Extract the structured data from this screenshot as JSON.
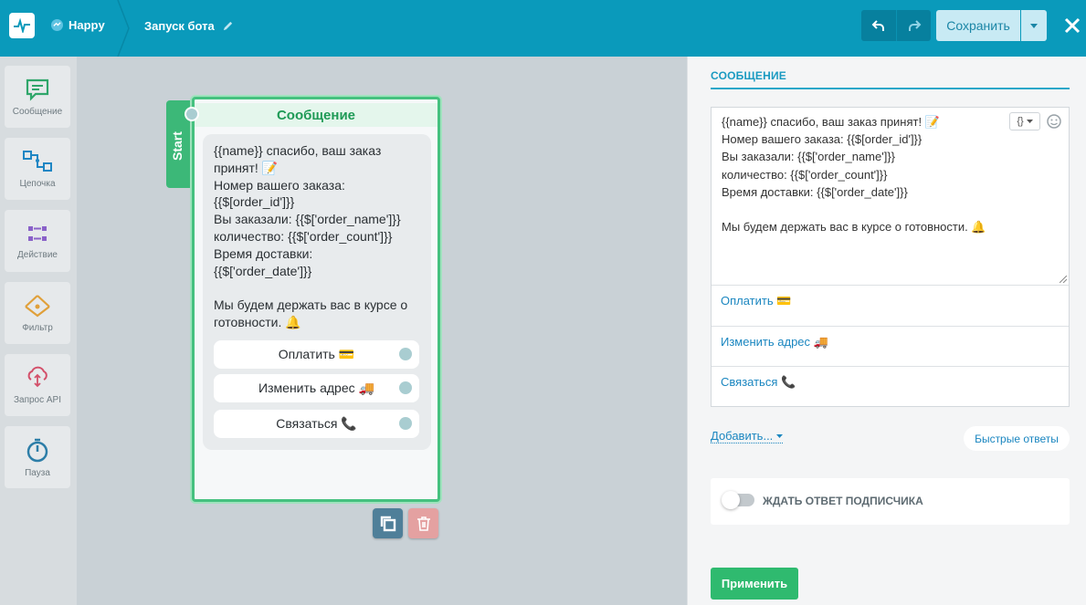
{
  "header": {
    "bot_name": "Happy",
    "flow_name": "Запуск бота",
    "save_label": "Сохранить"
  },
  "toolbox": {
    "items": [
      {
        "label": "Сообщение",
        "icon": "message-icon"
      },
      {
        "label": "Цепочка",
        "icon": "chain-icon"
      },
      {
        "label": "Действие",
        "icon": "action-icon"
      },
      {
        "label": "Фильтр",
        "icon": "filter-icon"
      },
      {
        "label": "Запрос API",
        "icon": "api-request-icon"
      },
      {
        "label": "Пауза",
        "icon": "timer-icon"
      }
    ]
  },
  "node": {
    "start_label": "Start",
    "title": "Сообщение",
    "text": "{{name}} спасибо, ваш заказ\nпринят! 📝\nНомер вашего заказа:\n{{$[order_id']}}\nВы заказали: {{$['order_name']}}\nколичество: {{$['order_count']}}\nВремя доставки:\n{{$['order_date']}}\n\nМы будем держать вас в курсе о\nготовности. 🔔",
    "buttons": [
      {
        "label": "Оплатить 💳"
      },
      {
        "label": "Изменить адрес 🚚"
      },
      {
        "label": "Связаться 📞"
      }
    ]
  },
  "panel": {
    "title": "СООБЩЕНИЕ",
    "message_text": "{{name}} спасибо, ваш заказ принят! 📝\nНомер вашего заказа: {{$[order_id']}}\nВы заказали: {{$['order_name']}}\nколичество: {{$['order_count']}}\nВремя доставки: {{$['order_date']}}\n\nМы будем держать вас в курсе о готовности. 🔔",
    "variable_button": "{}",
    "buttons": [
      {
        "label": "Оплатить 💳"
      },
      {
        "label": "Изменить адрес 🚚"
      },
      {
        "label": "Связаться 📞"
      }
    ],
    "add_label": "Добавить...",
    "quick_replies_label": "Быстрые ответы",
    "wait_label": "ЖДАТЬ ОТВЕТ ПОДПИСЧИКА",
    "wait_enabled": false,
    "apply_label": "Применить"
  },
  "colors": {
    "header": "#0a9abb",
    "accent_green": "#3cb878",
    "link": "#1a86c0"
  }
}
